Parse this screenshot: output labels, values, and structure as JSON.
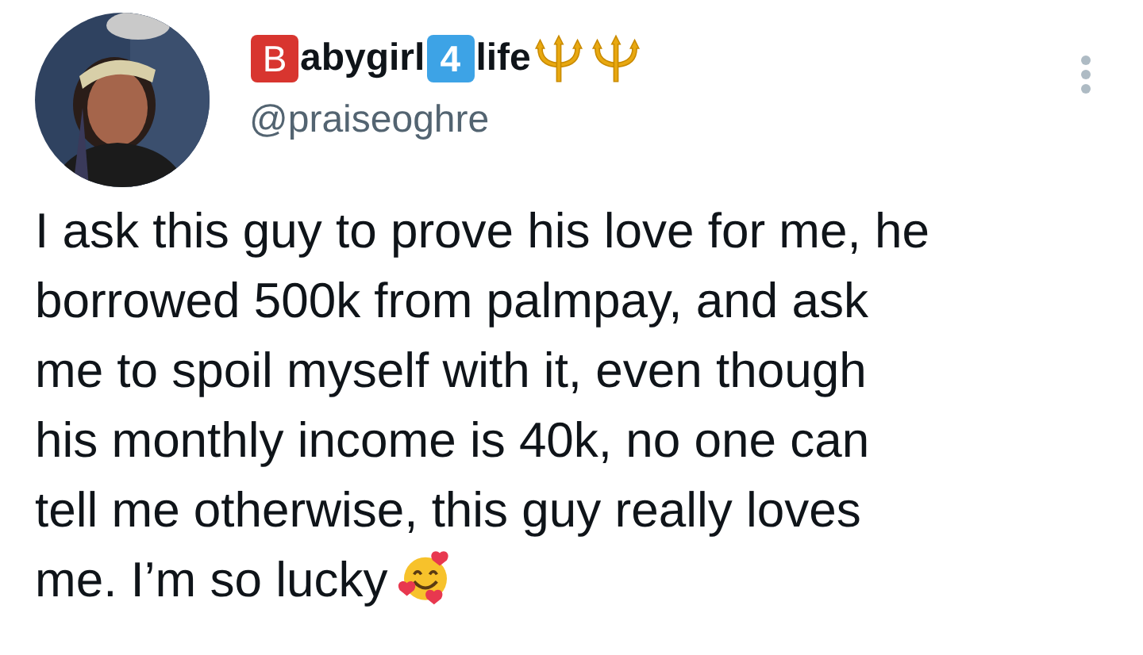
{
  "author": {
    "name_parts": [
      {
        "kind": "red-key",
        "text": "B"
      },
      {
        "kind": "plain",
        "text": "abygirl"
      },
      {
        "kind": "blue-key",
        "text": "4"
      },
      {
        "kind": "plain",
        "text": "life"
      }
    ],
    "handle": "@praiseoghre"
  },
  "tweet": {
    "lines": [
      "I ask this guy to prove his love for me, he",
      "borrowed 500k from palmpay, and ask",
      "me to spoil myself with it, even though",
      "his monthly income is 40k, no one can",
      "tell me otherwise, this guy really loves",
      "me. I’m so lucky"
    ]
  }
}
